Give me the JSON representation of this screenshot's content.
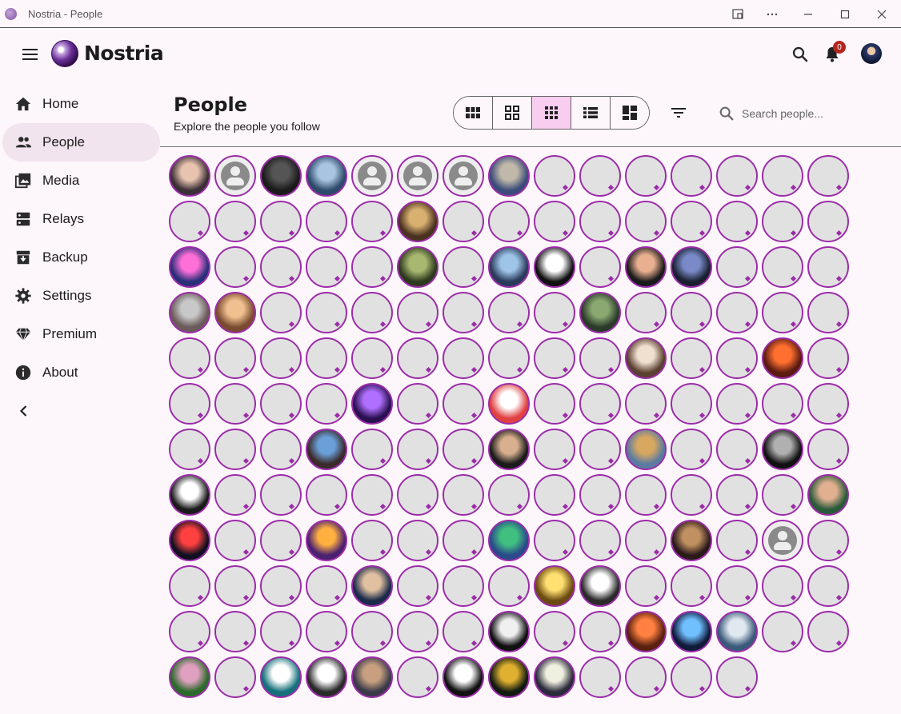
{
  "window": {
    "title": "Nostria - People",
    "controls": [
      "cast-icon",
      "more-icon",
      "minimize-icon",
      "maximize-icon",
      "close-icon"
    ]
  },
  "appbar": {
    "brand": "Nostria",
    "notification_count": "0"
  },
  "sidebar": {
    "items": [
      {
        "label": "Home",
        "icon": "home-icon",
        "active": false
      },
      {
        "label": "People",
        "icon": "people-icon",
        "active": true
      },
      {
        "label": "Media",
        "icon": "media-icon",
        "active": false
      },
      {
        "label": "Relays",
        "icon": "relays-icon",
        "active": false
      },
      {
        "label": "Backup",
        "icon": "backup-icon",
        "active": false
      },
      {
        "label": "Settings",
        "icon": "settings-icon",
        "active": false
      },
      {
        "label": "Premium",
        "icon": "premium-icon",
        "active": false
      },
      {
        "label": "About",
        "icon": "about-icon",
        "active": false
      }
    ]
  },
  "page": {
    "title": "People",
    "subtitle": "Explore the people you follow",
    "view_modes": [
      {
        "icon": "large-grid-icon",
        "active": false
      },
      {
        "icon": "medium-grid-icon",
        "active": false
      },
      {
        "icon": "small-grid-icon",
        "active": true
      },
      {
        "icon": "list-icon",
        "active": false
      },
      {
        "icon": "dashboard-icon",
        "active": false
      }
    ],
    "search_placeholder": "Search people..."
  },
  "colors": {
    "accent": "#9b2da8",
    "active_view_bg": "#f8cdf0",
    "active_nav_bg": "#f1e4ee",
    "badge": "#b3261e"
  },
  "people": {
    "count": 178,
    "avatars": [
      {
        "i": 0,
        "kind": "photo",
        "c": [
          "#e8c3b0",
          "#3a2f35"
        ]
      },
      {
        "i": 1,
        "kind": "default"
      },
      {
        "i": 2,
        "kind": "photo",
        "c": [
          "#555555",
          "#1a1a1a"
        ]
      },
      {
        "i": 3,
        "kind": "photo",
        "c": [
          "#a8c4e0",
          "#2c4a6a"
        ]
      },
      {
        "i": 4,
        "kind": "default"
      },
      {
        "i": 5,
        "kind": "default"
      },
      {
        "i": 6,
        "kind": "default"
      },
      {
        "i": 7,
        "kind": "photo",
        "c": [
          "#c0b8a8",
          "#3c4c7a"
        ]
      },
      {
        "i": 20,
        "kind": "photo",
        "c": [
          "#d8b070",
          "#4a3220"
        ]
      },
      {
        "i": 30,
        "kind": "photo",
        "c": [
          "#ff6fd8",
          "#2a2f7a"
        ]
      },
      {
        "i": 35,
        "kind": "photo",
        "c": [
          "#a8b870",
          "#2e3a1e"
        ]
      },
      {
        "i": 37,
        "kind": "photo",
        "c": [
          "#9ec4e8",
          "#2a3a5a"
        ]
      },
      {
        "i": 38,
        "kind": "photo",
        "c": [
          "#ffffff",
          "#111111"
        ]
      },
      {
        "i": 40,
        "kind": "photo",
        "c": [
          "#e8b090",
          "#1a1a1a"
        ]
      },
      {
        "i": 41,
        "kind": "photo",
        "c": [
          "#7a8ac8",
          "#1a2030"
        ]
      },
      {
        "i": 45,
        "kind": "photo",
        "c": [
          "#c8c8c8",
          "#6a5a5a"
        ]
      },
      {
        "i": 46,
        "kind": "photo",
        "c": [
          "#f0c090",
          "#7a4a30"
        ]
      },
      {
        "i": 54,
        "kind": "photo",
        "c": [
          "#8aa870",
          "#2a3a2a"
        ]
      },
      {
        "i": 70,
        "kind": "photo",
        "c": [
          "#f0e0d0",
          "#5a4030"
        ]
      },
      {
        "i": 73,
        "kind": "photo",
        "c": [
          "#ff7030",
          "#5a1a10"
        ]
      },
      {
        "i": 79,
        "kind": "photo",
        "c": [
          "#b070ff",
          "#2a1050"
        ]
      },
      {
        "i": 82,
        "kind": "photo",
        "c": [
          "#ffffff",
          "#e04040"
        ]
      },
      {
        "i": 93,
        "kind": "photo",
        "c": [
          "#6aa0d8",
          "#3a2a2a"
        ]
      },
      {
        "i": 97,
        "kind": "photo",
        "c": [
          "#d8b090",
          "#1a1a1a"
        ]
      },
      {
        "i": 100,
        "kind": "photo",
        "c": [
          "#d8a860",
          "#5a7aa0"
        ]
      },
      {
        "i": 103,
        "kind": "photo",
        "c": [
          "#b0b0b0",
          "#111111"
        ]
      },
      {
        "i": 105,
        "kind": "photo",
        "c": [
          "#ffffff",
          "#1a1a1a"
        ]
      },
      {
        "i": 119,
        "kind": "photo",
        "c": [
          "#e0b090",
          "#2a5a3a"
        ]
      },
      {
        "i": 120,
        "kind": "photo",
        "c": [
          "#ff4040",
          "#101020"
        ]
      },
      {
        "i": 123,
        "kind": "photo",
        "c": [
          "#ffb040",
          "#4a2070"
        ]
      },
      {
        "i": 127,
        "kind": "photo",
        "c": [
          "#40c080",
          "#2a4a8a"
        ]
      },
      {
        "i": 131,
        "kind": "photo",
        "c": [
          "#c09060",
          "#2a1a1a"
        ]
      },
      {
        "i": 133,
        "kind": "default"
      },
      {
        "i": 139,
        "kind": "photo",
        "c": [
          "#e0c0a0",
          "#1a2a4a"
        ]
      },
      {
        "i": 143,
        "kind": "photo",
        "c": [
          "#ffe070",
          "#6a4a10"
        ]
      },
      {
        "i": 144,
        "kind": "photo",
        "c": [
          "#ffffff",
          "#2a2a2a"
        ]
      },
      {
        "i": 157,
        "kind": "photo",
        "c": [
          "#f0f0f0",
          "#101010"
        ]
      },
      {
        "i": 160,
        "kind": "photo",
        "c": [
          "#ff8040",
          "#5a2010"
        ]
      },
      {
        "i": 161,
        "kind": "photo",
        "c": [
          "#70c0ff",
          "#101a3a"
        ]
      },
      {
        "i": 162,
        "kind": "photo",
        "c": [
          "#e0e8f0",
          "#3a5a7a"
        ]
      },
      {
        "i": 165,
        "kind": "photo",
        "c": [
          "#e0a0c0",
          "#2a6a2a"
        ]
      },
      {
        "i": 167,
        "kind": "photo",
        "c": [
          "#ffffff",
          "#14707a"
        ]
      },
      {
        "i": 168,
        "kind": "photo",
        "c": [
          "#ffffff",
          "#2a2a2a"
        ]
      },
      {
        "i": 169,
        "kind": "photo",
        "c": [
          "#c8a080",
          "#3a3a4a"
        ]
      },
      {
        "i": 171,
        "kind": "photo",
        "c": [
          "#ffffff",
          "#111111"
        ]
      },
      {
        "i": 172,
        "kind": "photo",
        "c": [
          "#e0b030",
          "#101a10"
        ]
      },
      {
        "i": 173,
        "kind": "photo",
        "c": [
          "#f0f0e0",
          "#2a2a3a"
        ]
      }
    ]
  }
}
